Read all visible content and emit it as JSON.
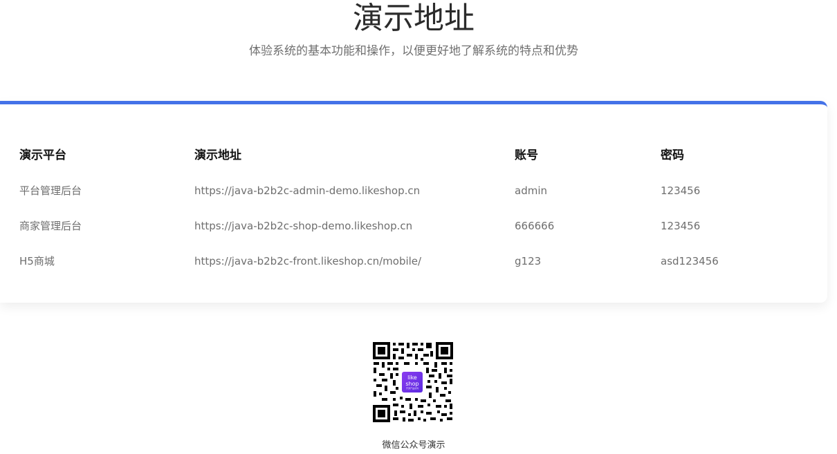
{
  "header": {
    "title": "演示地址",
    "subtitle": "体验系统的基本功能和操作，以便更好地了解系统的特点和优势"
  },
  "table": {
    "headers": [
      "演示平台",
      "演示地址",
      "账号",
      "密码"
    ],
    "rows": [
      [
        "平台管理后台",
        "https://java-b2b2c-admin-demo.likeshop.cn",
        "admin",
        "123456"
      ],
      [
        "商家管理后台",
        "https://java-b2b2c-shop-demo.likeshop.cn",
        "666666",
        "123456"
      ],
      [
        "H5商城",
        "https://java-b2b2c-front.likeshop.cn/mobile/",
        "g123",
        "asd123456"
      ]
    ]
  },
  "qr": {
    "logo_line_1": "like",
    "logo_line_2": "shop",
    "logo_tagline": "开源产品系列",
    "caption": "微信公众号演示"
  },
  "colors": {
    "accent": "#4472e8",
    "logo_purple": "#8b3cf0"
  },
  "icons": {
    "qr_code": "qr-code-icon",
    "logo": "likeshop-logo-icon"
  }
}
